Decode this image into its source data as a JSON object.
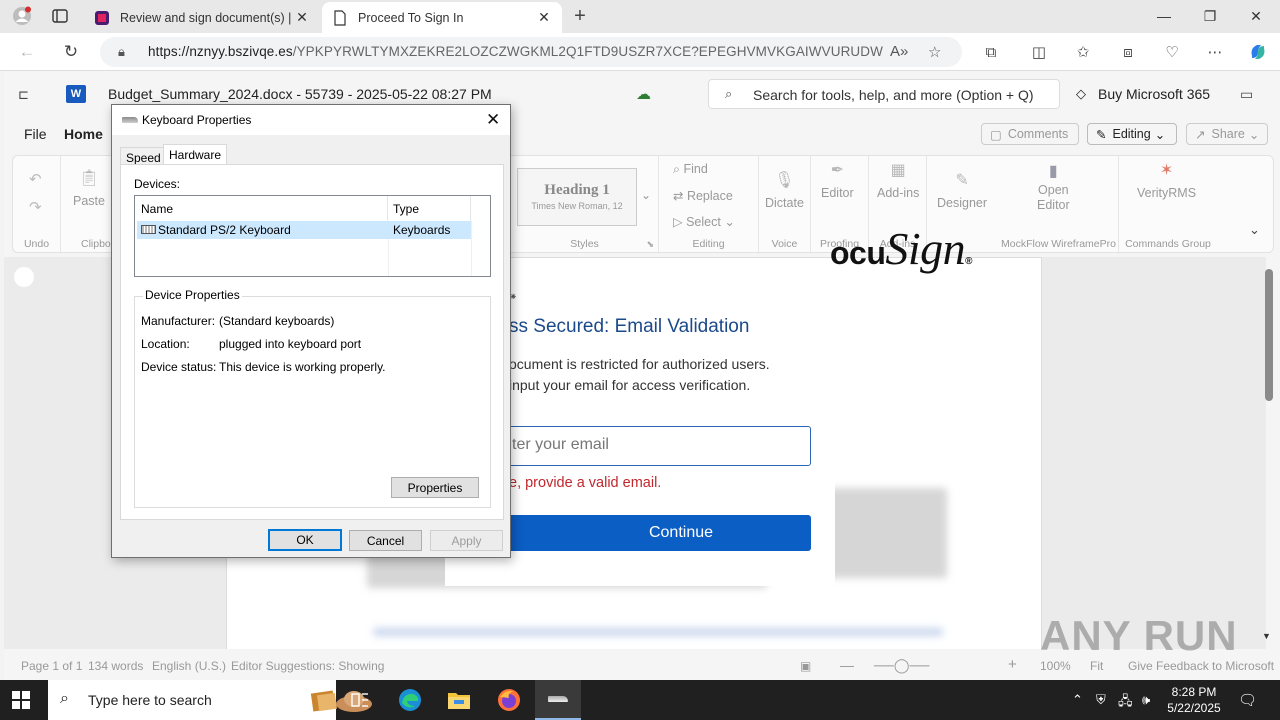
{
  "browser": {
    "tabs": [
      {
        "title": "Review and sign document(s) | D",
        "active": false
      },
      {
        "title": "Proceed To Sign In",
        "active": true
      }
    ],
    "url_host": "https://nznyy.bszivqe.es",
    "url_path": "/YPKPYRWLTYMXZEKRE2LOZCZWGKML2Q1FTD9USZR7XCE?EPEGHVMVKGAIWVURUDW"
  },
  "word": {
    "doc_title": "Budget_Summary_2024.docx - 55739 - 2025-05-22 08:27 PM",
    "search_placeholder": "Search for tools, help, and more (Option + Q)",
    "buy_label": "Buy Microsoft 365",
    "menu": {
      "file": "File",
      "home": "Home"
    },
    "comments_label": "Comments",
    "editing_label": "Editing",
    "share_label": "Share",
    "ribbon": {
      "undo_group": "Undo",
      "paste": "Paste",
      "clipboard_group": "Clipbo",
      "style_heading": "Heading 1",
      "style_font": "Times New Roman, 12",
      "styles_group": "Styles",
      "find": "Find",
      "replace": "Replace",
      "select": "Select",
      "editing_group": "Editing",
      "dictate": "Dictate",
      "voice_group": "Voice",
      "editor": "Editor",
      "proofing_group": "Proofing",
      "addins": "Add-ins",
      "addins_group": "Add-ins",
      "designer": "Designer",
      "open_editor_1": "Open",
      "open_editor_2": "Editor",
      "mockflow_group": "MockFlow WireframePro",
      "verityrms": "VerityRMS",
      "commands_group": "Commands Group"
    },
    "status": {
      "page": "Page 1 of 1",
      "words": "134 words",
      "language": "English (U.S.)",
      "editor": "Editor Suggestions: Showing",
      "zoom": "100%",
      "fit": "Fit",
      "feedback": "Give Feedback to Microsoft"
    }
  },
  "phish": {
    "heading": "ss Secured: Email Validation",
    "line1": "ocument is restricted for authorized users.",
    "line2": "input your email for access verification.",
    "email_placeholder": "ter your email",
    "error": "e, provide a valid email.",
    "continue": "Continue",
    "brand_a": "ocu",
    "brand_b": "Sign"
  },
  "dialog": {
    "title": "Keyboard Properties",
    "tab_speed": "Speed",
    "tab_hardware": "Hardware",
    "devices_label": "Devices:",
    "col_name": "Name",
    "col_type": "Type",
    "device_name": "Standard PS/2 Keyboard",
    "device_type": "Keyboards",
    "props_group": "Device Properties",
    "manufacturer_k": "Manufacturer:",
    "manufacturer_v": "(Standard keyboards)",
    "location_k": "Location:",
    "location_v": "plugged into keyboard port",
    "status_k": "Device status:",
    "status_v": "This device is working properly.",
    "properties_btn": "Properties",
    "ok": "OK",
    "cancel": "Cancel",
    "apply": "Apply"
  },
  "taskbar": {
    "search_placeholder": "Type here to search",
    "time": "8:28 PM",
    "date": "5/22/2025"
  },
  "watermark": "ANY RUN"
}
